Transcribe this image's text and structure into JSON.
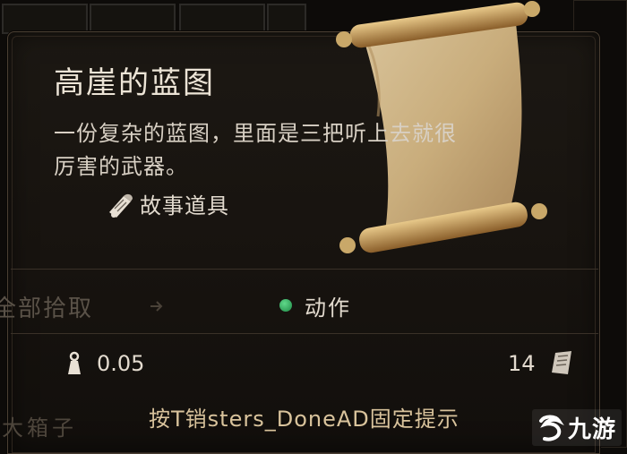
{
  "item": {
    "name": "高崖的蓝图",
    "description_line1": "一份复杂的蓝图，里面是三把听上去就很",
    "description_line2": "厉害的武器。",
    "category": "故事道具",
    "category_icon": "scroll-tag-icon",
    "image_icon": "scroll-icon"
  },
  "actions": {
    "pickup_all": "全部拾取",
    "action_label": "动作"
  },
  "stats": {
    "weight": "0.05",
    "value": "14"
  },
  "hint": {
    "text": "按T销sters_DoneAD固定提示"
  },
  "background": {
    "container_label": "大箱子"
  },
  "watermark": {
    "text": "九游"
  },
  "colors": {
    "accent_green": "#2fae5a",
    "hint_gold": "#d9c39c"
  }
}
